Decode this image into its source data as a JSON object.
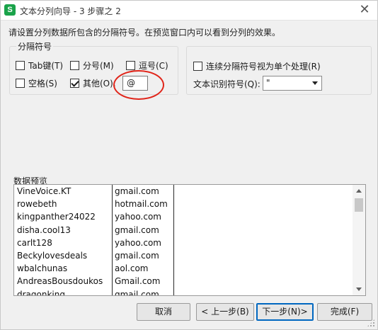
{
  "window": {
    "title": "文本分列向导 - 3 步骤之 2",
    "app_icon_letter": "S",
    "close_symbol": "✕"
  },
  "instruction": "请设置分列数据所包含的分隔符号。在预览窗口内可以看到分列的效果。",
  "delimiters": {
    "group_label": "分隔符号",
    "tab": {
      "label": "Tab键(T)",
      "checked": false
    },
    "semicolon": {
      "label": "分号(M)",
      "checked": false
    },
    "comma": {
      "label": "逗号(C)",
      "checked": false
    },
    "space": {
      "label": "空格(S)",
      "checked": false
    },
    "other": {
      "label": "其他(O):",
      "checked": true,
      "value": "@"
    }
  },
  "options": {
    "consecutive": {
      "label": "连续分隔符号视为单个处理(R)",
      "checked": false
    },
    "qualifier_label": "文本识别符号(Q):",
    "qualifier_value": "\""
  },
  "preview": {
    "label": "数据预览",
    "col1": [
      "VineVoice.KT",
      "rowebeth",
      "kingpanther24022",
      "disha.cool13",
      "carlt128",
      "Beckylovesdeals",
      "wbalchunas",
      "AndreasBousdoukos",
      "dragonking"
    ],
    "col2": [
      "gmail.com",
      "hotmail.com",
      "yahoo.com",
      "gmail.com",
      "yahoo.com",
      "gmail.com",
      "aol.com",
      "Gmail.com",
      "gmail.com"
    ]
  },
  "buttons": {
    "cancel": "取消",
    "prev": "< 上一步(B)",
    "next": "下一步(N)>",
    "finish": "完成(F)"
  },
  "colors": {
    "annotation_circle": "#e0251a",
    "app_icon": "#1aa34a",
    "focus_border": "#0067c0"
  }
}
